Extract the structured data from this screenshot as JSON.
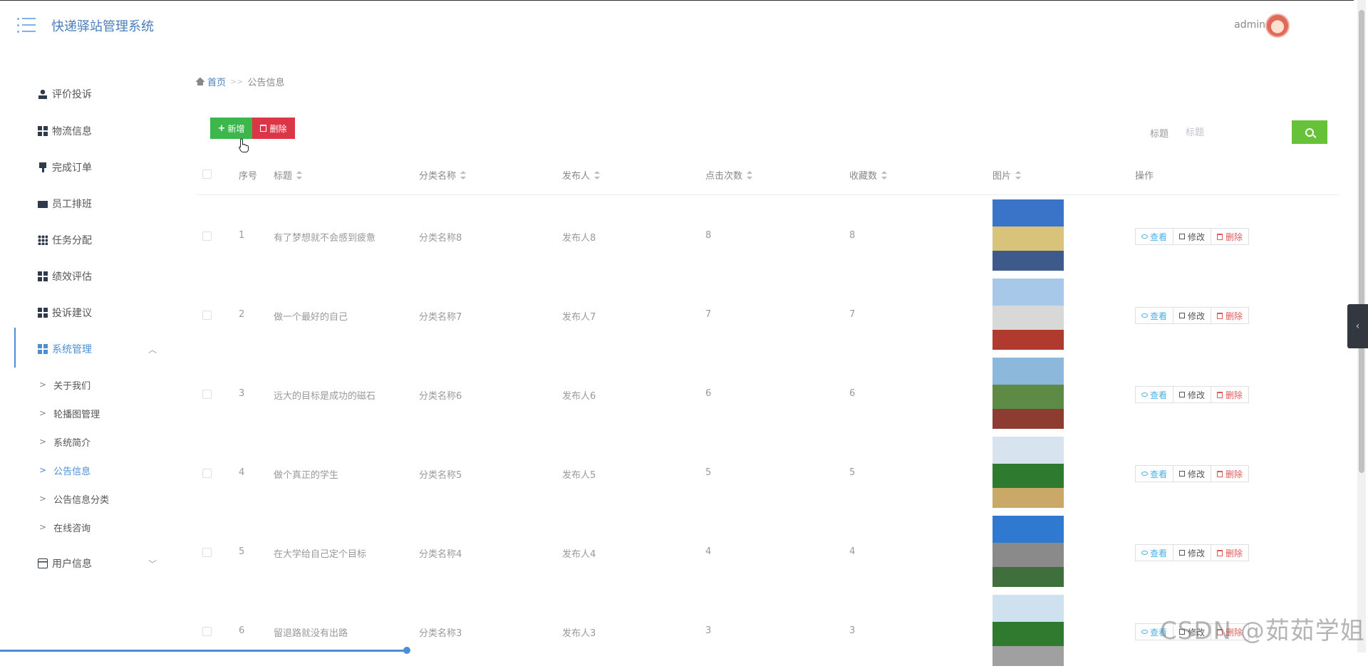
{
  "app": {
    "title": "快递驿站管理系统",
    "user": "admin"
  },
  "sidebar": {
    "items": [
      {
        "label": "评价投诉",
        "icon": "user-icon"
      },
      {
        "label": "物流信息",
        "icon": "grid-icon"
      },
      {
        "label": "完成订单",
        "icon": "stamp-icon"
      },
      {
        "label": "员工排班",
        "icon": "wallet-icon"
      },
      {
        "label": "任务分配",
        "icon": "grid9-icon"
      },
      {
        "label": "绩效评估",
        "icon": "grid-icon"
      },
      {
        "label": "投诉建议",
        "icon": "grid-icon"
      },
      {
        "label": "系统管理",
        "icon": "grid-icon",
        "expanded": true
      },
      {
        "label": "用户信息",
        "icon": "card-icon",
        "expanded": false
      }
    ],
    "sub_items": [
      {
        "label": "关于我们"
      },
      {
        "label": "轮播图管理"
      },
      {
        "label": "系统简介"
      },
      {
        "label": "公告信息",
        "active": true
      },
      {
        "label": "公告信息分类"
      },
      {
        "label": "在线咨询"
      }
    ]
  },
  "breadcrumb": {
    "home": "首页",
    "separator": ">>",
    "current": "公告信息"
  },
  "toolbar": {
    "add_label": "新增",
    "delete_label": "删除"
  },
  "search": {
    "label": "标题",
    "placeholder": "标题"
  },
  "table": {
    "columns": [
      "序号",
      "标题",
      "分类名称",
      "发布人",
      "点击次数",
      "收藏数",
      "图片",
      "操作"
    ],
    "rows": [
      {
        "index": "1",
        "title": "有了梦想就不会感到疲惫",
        "category": "分类名称8",
        "publisher": "发布人8",
        "clicks": "8",
        "favorites": "8"
      },
      {
        "index": "2",
        "title": "做一个最好的自己",
        "category": "分类名称7",
        "publisher": "发布人7",
        "clicks": "7",
        "favorites": "7"
      },
      {
        "index": "3",
        "title": "远大的目标是成功的磁石",
        "category": "分类名称6",
        "publisher": "发布人6",
        "clicks": "6",
        "favorites": "6"
      },
      {
        "index": "4",
        "title": "做个真正的学生",
        "category": "分类名称5",
        "publisher": "发布人5",
        "clicks": "5",
        "favorites": "5"
      },
      {
        "index": "5",
        "title": "在大学给自己定个目标",
        "category": "分类名称4",
        "publisher": "发布人4",
        "clicks": "4",
        "favorites": "4"
      },
      {
        "index": "6",
        "title": "留退路就没有出路",
        "category": "分类名称3",
        "publisher": "发布人3",
        "clicks": "3",
        "favorites": "3"
      }
    ],
    "actions": {
      "view": "查看",
      "edit": "修改",
      "delete": "删除"
    }
  },
  "watermark": "CSDN @茹茹学姐",
  "colors": {
    "accent": "#4a8fd6",
    "add": "#3cb74b",
    "delete": "#dc3545",
    "search": "#67c23a"
  }
}
